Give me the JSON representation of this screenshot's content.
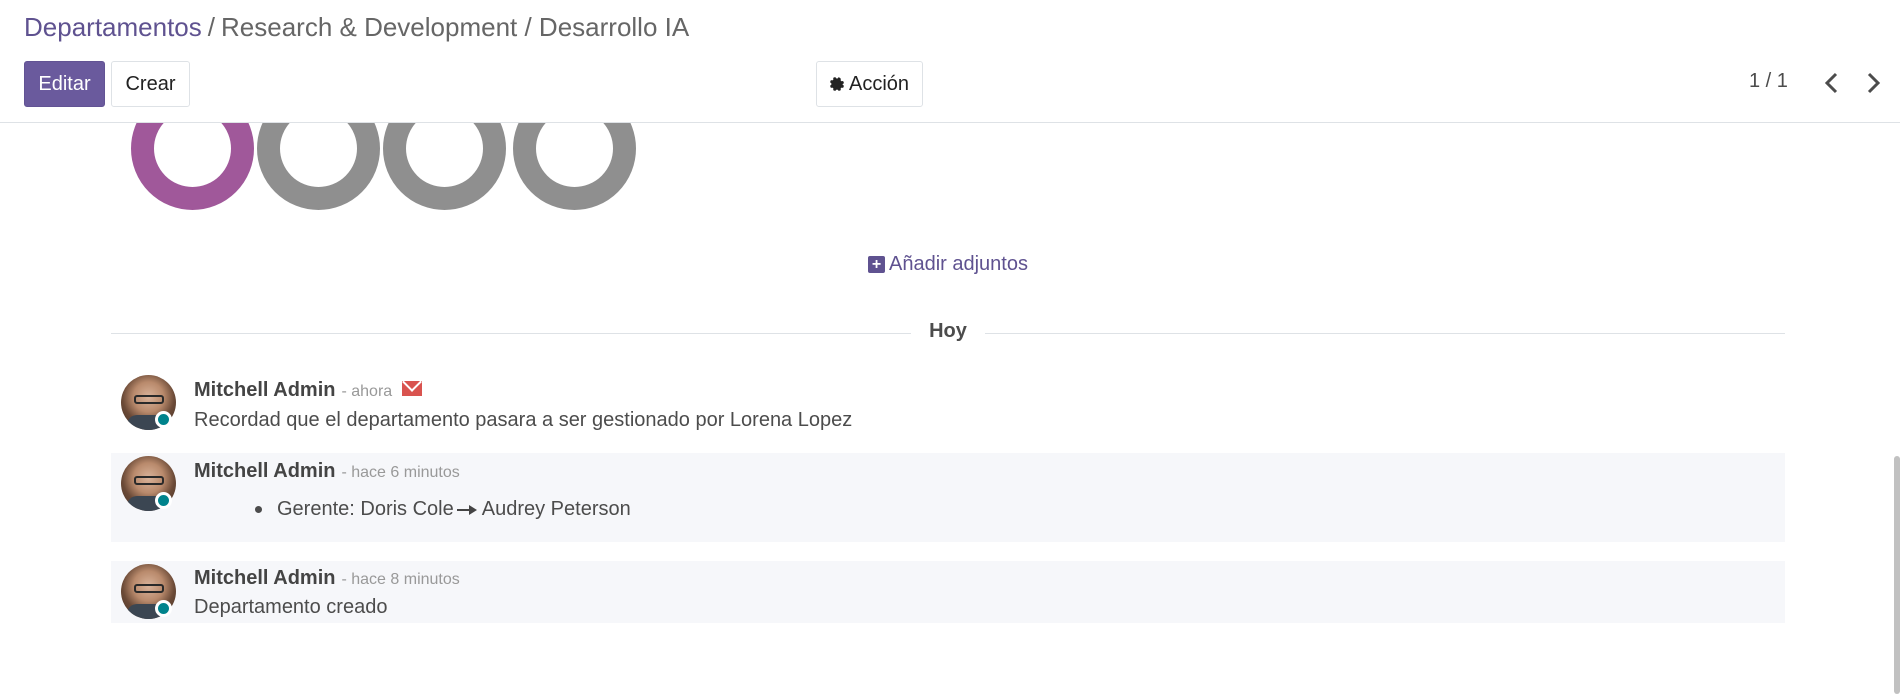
{
  "breadcrumb": {
    "root": "Departamentos",
    "separator": "/",
    "current": "Research & Development / Desarrollo IA"
  },
  "buttons": {
    "edit": "Editar",
    "create": "Crear",
    "action": "Acción"
  },
  "pager": {
    "value": "1 / 1"
  },
  "attachments": {
    "add_label": "Añadir adjuntos",
    "ring_colors": [
      "#a0589a",
      "#8f8f8f",
      "#8f8f8f",
      "#8f8f8f"
    ]
  },
  "chatter": {
    "day_label": "Hoy",
    "messages": [
      {
        "author": "Mitchell Admin",
        "date": "- ahora",
        "body": "Recordad que el departamento pasara a ser gestionado por Lorena Lopez",
        "icon": "envelope-icon"
      },
      {
        "author": "Mitchell Admin",
        "date": "- hace 6 minutos",
        "tracking": {
          "field": "Gerente:",
          "old_value": "Doris Cole",
          "new_value": "Audrey Peterson"
        }
      },
      {
        "author": "Mitchell Admin",
        "date": "- hace 8 minutos",
        "body": "Departamento creado"
      }
    ]
  },
  "colors": {
    "brand": "#6a5a9d",
    "presence_online": "#00838c",
    "envelope": "#d9534f"
  }
}
